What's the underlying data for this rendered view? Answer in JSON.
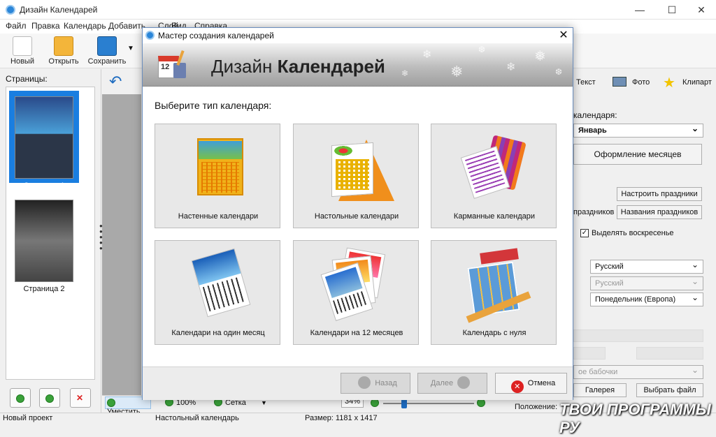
{
  "window": {
    "title": "Дизайн Календарей",
    "minimize": "—",
    "maximize": "☐",
    "close": "✕"
  },
  "menu": [
    "Файл",
    "Правка",
    "Календарь",
    "Добавить",
    "Слой",
    "Вид",
    "Справка"
  ],
  "toolbar": {
    "new": "Новый",
    "open": "Открыть",
    "save": "Сохранить"
  },
  "pages": {
    "label": "Страницы:",
    "items": [
      {
        "label": "Страница 1"
      },
      {
        "label": "Страница 2"
      }
    ]
  },
  "right": {
    "tabs": [
      "Текст",
      "Фото",
      "Клипарт"
    ],
    "month_label": "календаря:",
    "month_value": "Январь",
    "design_months": "Оформление месяцев",
    "holidays_btn": "Настроить праздники",
    "holidays_label": "праздников",
    "holiday_names": "Названия праздников",
    "highlight_sunday": "Выделять воскресенье",
    "lang1": "Русский",
    "lang2": "Русский",
    "week_start": "Понедельник (Европа)",
    "butterflies": "ое бабочки",
    "gallery": "Галерея",
    "choose_file": "Выбрать файл",
    "position": "Положение:"
  },
  "bottom": {
    "fit": "Уместить",
    "zoom": "100%",
    "grid": "Сетка",
    "scale": "34%"
  },
  "status": {
    "project": "Новый проект",
    "type": "Настольный календарь",
    "size": "Размер: 1181 x 1417"
  },
  "watermark": "ТВОИ ПРОГРАММЫ РУ",
  "dialog": {
    "title": "Мастер создания календарей",
    "close": "✕",
    "banner_plain": "Дизайн ",
    "banner_bold": "Календарей",
    "banner_date": "12",
    "subtitle": "Выберите тип календаря:",
    "cards": [
      {
        "label": "Настенные календари"
      },
      {
        "label": "Настольные календари"
      },
      {
        "label": "Карманные календари"
      },
      {
        "label": "Календари на один месяц"
      },
      {
        "label": "Календари на 12 месяцев"
      },
      {
        "label": "Календарь с нуля"
      }
    ],
    "back": "Назад",
    "next": "Далее",
    "cancel": "Отмена"
  }
}
